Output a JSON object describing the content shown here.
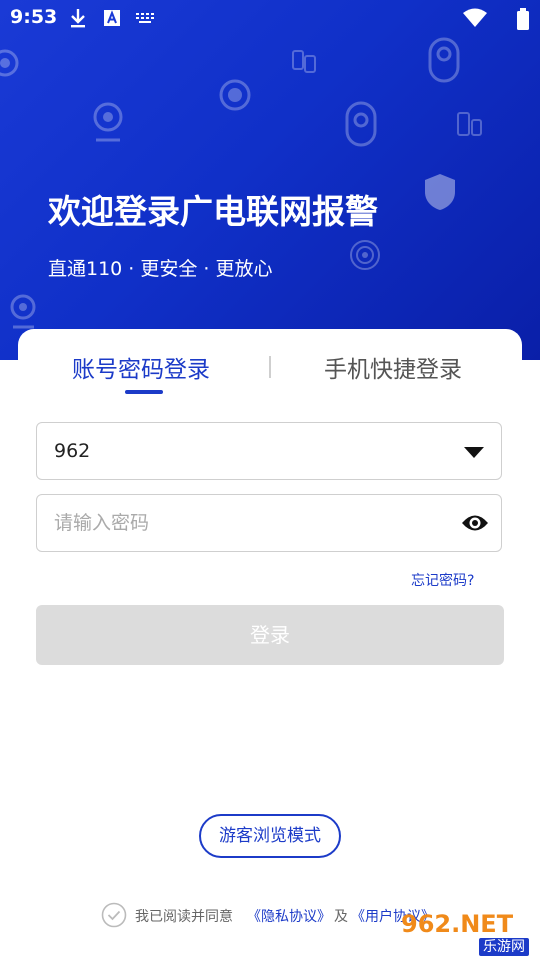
{
  "status_bar": {
    "time": "9:53"
  },
  "hero": {
    "title": "欢迎登录广电联网报警",
    "subtitle": "直通110 · 更安全 · 更放心"
  },
  "tabs": [
    {
      "label": "账号密码登录",
      "active": true
    },
    {
      "label": "手机快捷登录",
      "active": false
    }
  ],
  "form": {
    "account_value": "962",
    "password_placeholder": "请输入密码",
    "forgot_label": "忘记密码?",
    "login_label": "登录"
  },
  "guest_label": "游客浏览模式",
  "agreement": {
    "prefix": "我已阅读并同意",
    "privacy": "《隐私协议》",
    "and": "及",
    "user": "《用户协议》"
  },
  "watermark": {
    "brand": "962.NET",
    "sub": "乐游网"
  },
  "colors": {
    "primary": "#1c3bc8",
    "hero": "#1030c8",
    "disabled": "#dcdcdc"
  },
  "icons": [
    "download-icon",
    "font-icon",
    "keyboard-icon",
    "wifi-icon",
    "battery-icon",
    "dropdown-icon",
    "eye-icon",
    "check-icon"
  ]
}
